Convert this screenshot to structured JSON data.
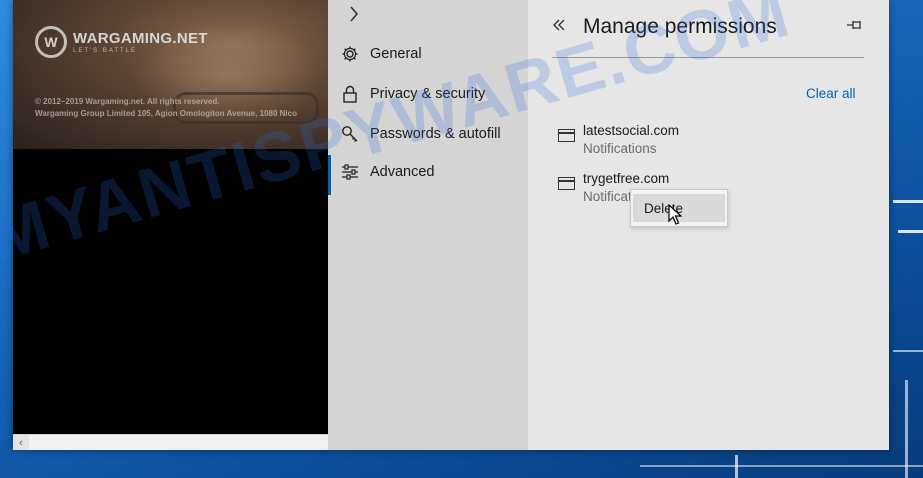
{
  "webpage": {
    "logo_name": "WARGAMING.NET",
    "logo_tagline": "LET'S BATTLE",
    "copyright_line1": "© 2012–2019 Wargaming.net. All rights reserved.",
    "copyright_line2": "Wargaming Group Limited 105, Agion Omologiton Avenue, 1080 Nico"
  },
  "settings_menu": {
    "items": [
      {
        "label": "General",
        "icon": "gear-icon"
      },
      {
        "label": "Privacy & security",
        "icon": "lock-icon"
      },
      {
        "label": "Passwords & autofill",
        "icon": "key-icon"
      },
      {
        "label": "Advanced",
        "icon": "sliders-icon",
        "active": true
      }
    ]
  },
  "panel": {
    "title": "Manage permissions",
    "clear_all": "Clear all",
    "sites": [
      {
        "name": "latestsocial.com",
        "permission": "Notifications"
      },
      {
        "name": "trygetfree.com",
        "permission": "Notificat"
      }
    ]
  },
  "context_menu": {
    "delete_label": "Delete"
  },
  "watermark": "MYANTISPYWARE.COM",
  "colors": {
    "accent": "#0063b1",
    "menu_bg": "#d4d4d4",
    "panel_bg": "#e6e6e6"
  }
}
